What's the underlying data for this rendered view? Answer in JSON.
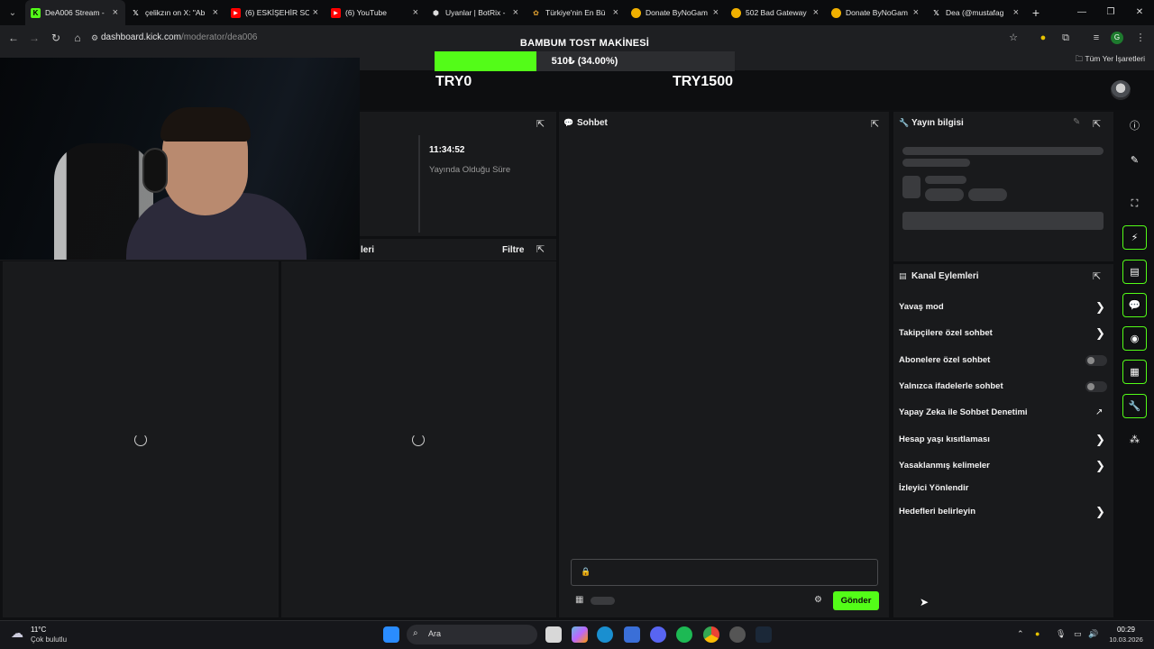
{
  "browser": {
    "tabs": [
      {
        "title": "DeA006 Stream -",
        "favicon": "kick",
        "color": "#53fc18"
      },
      {
        "title": "çelikzın on X: \"Ab",
        "favicon": "x",
        "color": "#ffffff"
      },
      {
        "title": "(6) ESKİŞEHİR SO",
        "favicon": "youtube",
        "color": "#ff0000"
      },
      {
        "title": "(6) YouTube",
        "favicon": "youtube",
        "color": "#ff0000"
      },
      {
        "title": "Uyanlar | BotRix -",
        "favicon": "botrix",
        "color": "#dddddd"
      },
      {
        "title": "Türkiye'nin En Bü",
        "favicon": "generic",
        "color": "#e0a030"
      },
      {
        "title": "Donate ByNoGam",
        "favicon": "bynogame",
        "color": "#f0b000"
      },
      {
        "title": "502 Bad Gateway",
        "favicon": "bynogame",
        "color": "#f0b000"
      },
      {
        "title": "Donate ByNoGam",
        "favicon": "bynogame",
        "color": "#f0b000"
      },
      {
        "title": "Dea (@mustafag",
        "favicon": "x",
        "color": "#ffffff"
      }
    ],
    "url_host": "dashboard.kick.com",
    "url_path": "/moderator/dea006",
    "all_bookmarks": "Tüm Yer İşaretleri"
  },
  "overlay": {
    "title": "BAMBUM TOST MAKİNESİ",
    "progress_text": "510₺ (34.00%)",
    "progress_fraction": 0.34,
    "goal_min": "TRY0",
    "goal_max": "TRY1500"
  },
  "stream_panel": {
    "uptime": "11:34:52",
    "uptime_label": "Yayında Olduğu Süre"
  },
  "panel2": {
    "title_fragment": "leri",
    "filter_label": "Filtre"
  },
  "chat": {
    "title": "Sohbet",
    "send_label": "Gönder"
  },
  "stream_info": {
    "title": "Yayın bilgisi"
  },
  "channel_actions": {
    "title": "Kanal Eylemleri",
    "items": [
      {
        "label": "Yavaş mod",
        "control": "chevron"
      },
      {
        "label": "Takipçilere özel sohbet",
        "control": "chevron"
      },
      {
        "label": "Abonelere özel sohbet",
        "control": "toggle"
      },
      {
        "label": "Yalnızca ifadelerle sohbet",
        "control": "toggle"
      },
      {
        "label": "Yapay Zeka ile Sohbet Denetimi",
        "control": "external"
      },
      {
        "label": "Hesap yaşı kısıtlaması",
        "control": "chevron"
      },
      {
        "label": "Yasaklanmış kelimeler",
        "control": "chevron"
      },
      {
        "label": "İzleyici Yönlendir",
        "control": "none"
      },
      {
        "label": "Hedefleri belirleyin",
        "control": "chevron"
      }
    ]
  },
  "taskbar": {
    "weather_temp": "11°C",
    "weather_condition": "Çok bulutlu",
    "search_label": "Ara",
    "time": "00:29",
    "date": "10.03.2026"
  },
  "colors": {
    "accent": "#53fc18",
    "panel": "#191a1c",
    "background": "#0f1012"
  }
}
